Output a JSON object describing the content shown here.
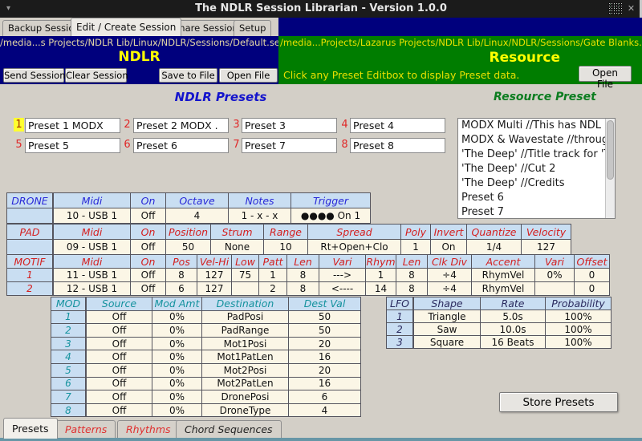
{
  "titlebar": {
    "title": "The NDLR Session Librarian - Version 1.0.0"
  },
  "top_tabs": [
    "Backup Session",
    "Edit / Create Session",
    "Share Session",
    "Setup"
  ],
  "ndlr_panel": {
    "path": "/media...s Projects/NDLR Lib/Linux/NDLR/Sessions/Default.ses",
    "title": "NDLR",
    "send_button": "Send Session",
    "clear_button": "Clear Session",
    "save_button": "Save to File",
    "open_button": "Open  File"
  },
  "resource_panel": {
    "path": "/media...Projects/Lazarus Projects/NDLR Lib/Linux/NDLR/Sessions/Gate Blanks.ses",
    "title": "Resource",
    "hint": "Click any Preset Editbox to display Preset data.",
    "open_button": "Open File"
  },
  "ndlr_presets": {
    "heading": "NDLR Presets",
    "items": [
      {
        "num": "1",
        "value": "Preset 1 MODX"
      },
      {
        "num": "2",
        "value": "Preset 2 MODX ."
      },
      {
        "num": "3",
        "value": "Preset 3"
      },
      {
        "num": "4",
        "value": "Preset 4"
      },
      {
        "num": "5",
        "value": "Preset 5"
      },
      {
        "num": "6",
        "value": "Preset 6"
      },
      {
        "num": "7",
        "value": "Preset 7"
      },
      {
        "num": "8",
        "value": "Preset 8"
      }
    ]
  },
  "resource_presets": {
    "heading": "Resource Preset",
    "items": [
      "MODX Multi    //This has NDL",
      "MODX & Wavestate //through",
      "'The Deep' //Title track for 'Th",
      "'The Deep' //Cut 2",
      "'The Deep' //Credits",
      "Preset 6",
      "Preset 7"
    ]
  },
  "drone_table": {
    "headers": [
      "DRONE",
      "Midi",
      "On",
      "Octave",
      "Notes",
      "Trigger"
    ],
    "rows": [
      [
        "",
        "10 - USB 1",
        "Off",
        "4",
        "1 - x - x",
        "●●●● On 1"
      ]
    ]
  },
  "pad_table": {
    "headers": [
      "PAD",
      "Midi",
      "On",
      "Position",
      "Strum",
      "Range",
      "Spread",
      "Poly",
      "Invert",
      "Quantize",
      "Velocity"
    ],
    "rows": [
      [
        "",
        "09 - USB 1",
        "Off",
        "50",
        "None",
        "10",
        "Rt+Open+Clo",
        "1",
        "On",
        "1/4",
        "127"
      ]
    ]
  },
  "motif_table": {
    "headers": [
      "MOTIF",
      "Midi",
      "On",
      "Pos",
      "Vel-Hi",
      "Low",
      "Patt",
      "Len",
      "Vari",
      "Rhym",
      "Len",
      "Clk Div",
      "Accent",
      "Vari",
      "Offset"
    ],
    "rows": [
      [
        "1",
        "11 - USB 1",
        "Off",
        "8",
        "127",
        "75",
        "1",
        "8",
        "--->",
        "1",
        "8",
        "÷4",
        "RhymVel",
        "0%",
        "0"
      ],
      [
        "2",
        "12 - USB 1",
        "Off",
        "6",
        "127",
        "",
        "2",
        "8",
        "<----",
        "14",
        "8",
        "÷4",
        "RhymVel",
        "",
        "0"
      ]
    ]
  },
  "mod_table": {
    "headers": [
      "MOD",
      "Source",
      "Mod Amt",
      "Destination",
      "Dest Val"
    ],
    "rows": [
      [
        "1",
        "Off",
        "0%",
        "PadPosi",
        "50"
      ],
      [
        "2",
        "Off",
        "0%",
        "PadRange",
        "50"
      ],
      [
        "3",
        "Off",
        "0%",
        "Mot1Posi",
        "20"
      ],
      [
        "4",
        "Off",
        "0%",
        "Mot1PatLen",
        "16"
      ],
      [
        "5",
        "Off",
        "0%",
        "Mot2Posi",
        "20"
      ],
      [
        "6",
        "Off",
        "0%",
        "Mot2PatLen",
        "16"
      ],
      [
        "7",
        "Off",
        "0%",
        "DronePosi",
        "6"
      ],
      [
        "8",
        "Off",
        "0%",
        "DroneType",
        "4"
      ]
    ]
  },
  "lfo_table": {
    "headers": [
      "LFO",
      "Shape",
      "Rate",
      "Probability"
    ],
    "rows": [
      [
        "1",
        "Triangle",
        "5.0s",
        "100%"
      ],
      [
        "2",
        "Saw",
        "10.0s",
        "100%"
      ],
      [
        "3",
        "Square",
        "16 Beats",
        "100%"
      ]
    ]
  },
  "store_button": "Store Presets",
  "bottom_tabs": [
    "Presets",
    "Patterns",
    "Rhythms",
    "Chord Sequences"
  ],
  "colors": {
    "panel_navy": "#00007d",
    "panel_green": "#007d00",
    "accent_yellow": "#ffff00",
    "header_blue": "#2828d8",
    "header_red": "#d42020",
    "header_teal": "#14929e",
    "header_navy": "#2a2a5e",
    "table_header_bg": "#c9def2",
    "table_cell_bg": "#fbf6e6"
  }
}
